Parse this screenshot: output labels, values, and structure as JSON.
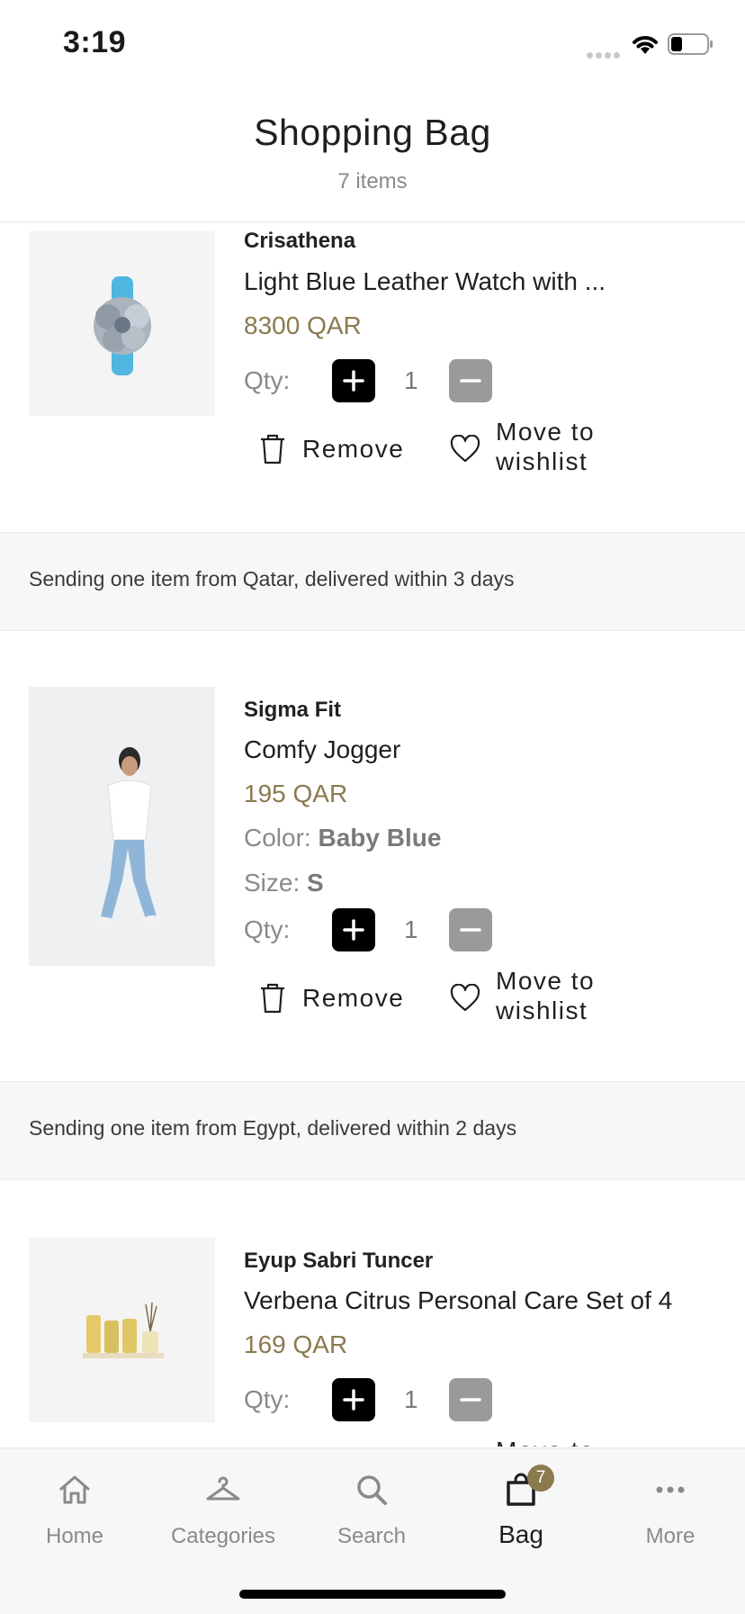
{
  "status_bar": {
    "time": "3:19"
  },
  "header": {
    "title": "Shopping Bag",
    "subtitle": "7 items"
  },
  "labels": {
    "qty": "Qty:",
    "remove": "Remove",
    "move_to_wishlist": "Move to wishlist",
    "color": "Color:",
    "size": "Size:"
  },
  "items": [
    {
      "brand": "Crisathena",
      "name": "Light Blue Leather Watch with ...",
      "price": "8300 QAR",
      "qty": "1"
    },
    {
      "brand": "Sigma Fit",
      "name": "Comfy Jogger",
      "price": "195 QAR",
      "color": "Baby Blue",
      "size": "S",
      "qty": "1"
    },
    {
      "brand": "Eyup Sabri Tuncer",
      "name": "Verbena Citrus Personal Care Set of 4",
      "price": "169 QAR",
      "qty": "1"
    }
  ],
  "shipping": [
    "Sending one item from Qatar, delivered within 3 days",
    "Sending one item from Egypt, delivered within 2 days"
  ],
  "tabbar": {
    "tabs": [
      {
        "label": "Home",
        "icon": "home-icon"
      },
      {
        "label": "Categories",
        "icon": "hanger-icon"
      },
      {
        "label": "Search",
        "icon": "search-icon"
      },
      {
        "label": "Bag",
        "icon": "bag-icon",
        "badge": "7",
        "active": true
      },
      {
        "label": "More",
        "icon": "more-icon"
      }
    ]
  },
  "colors": {
    "accent_gold": "#8a7a4e",
    "plus_button": "#000000",
    "minus_button": "#9a9a9a"
  }
}
